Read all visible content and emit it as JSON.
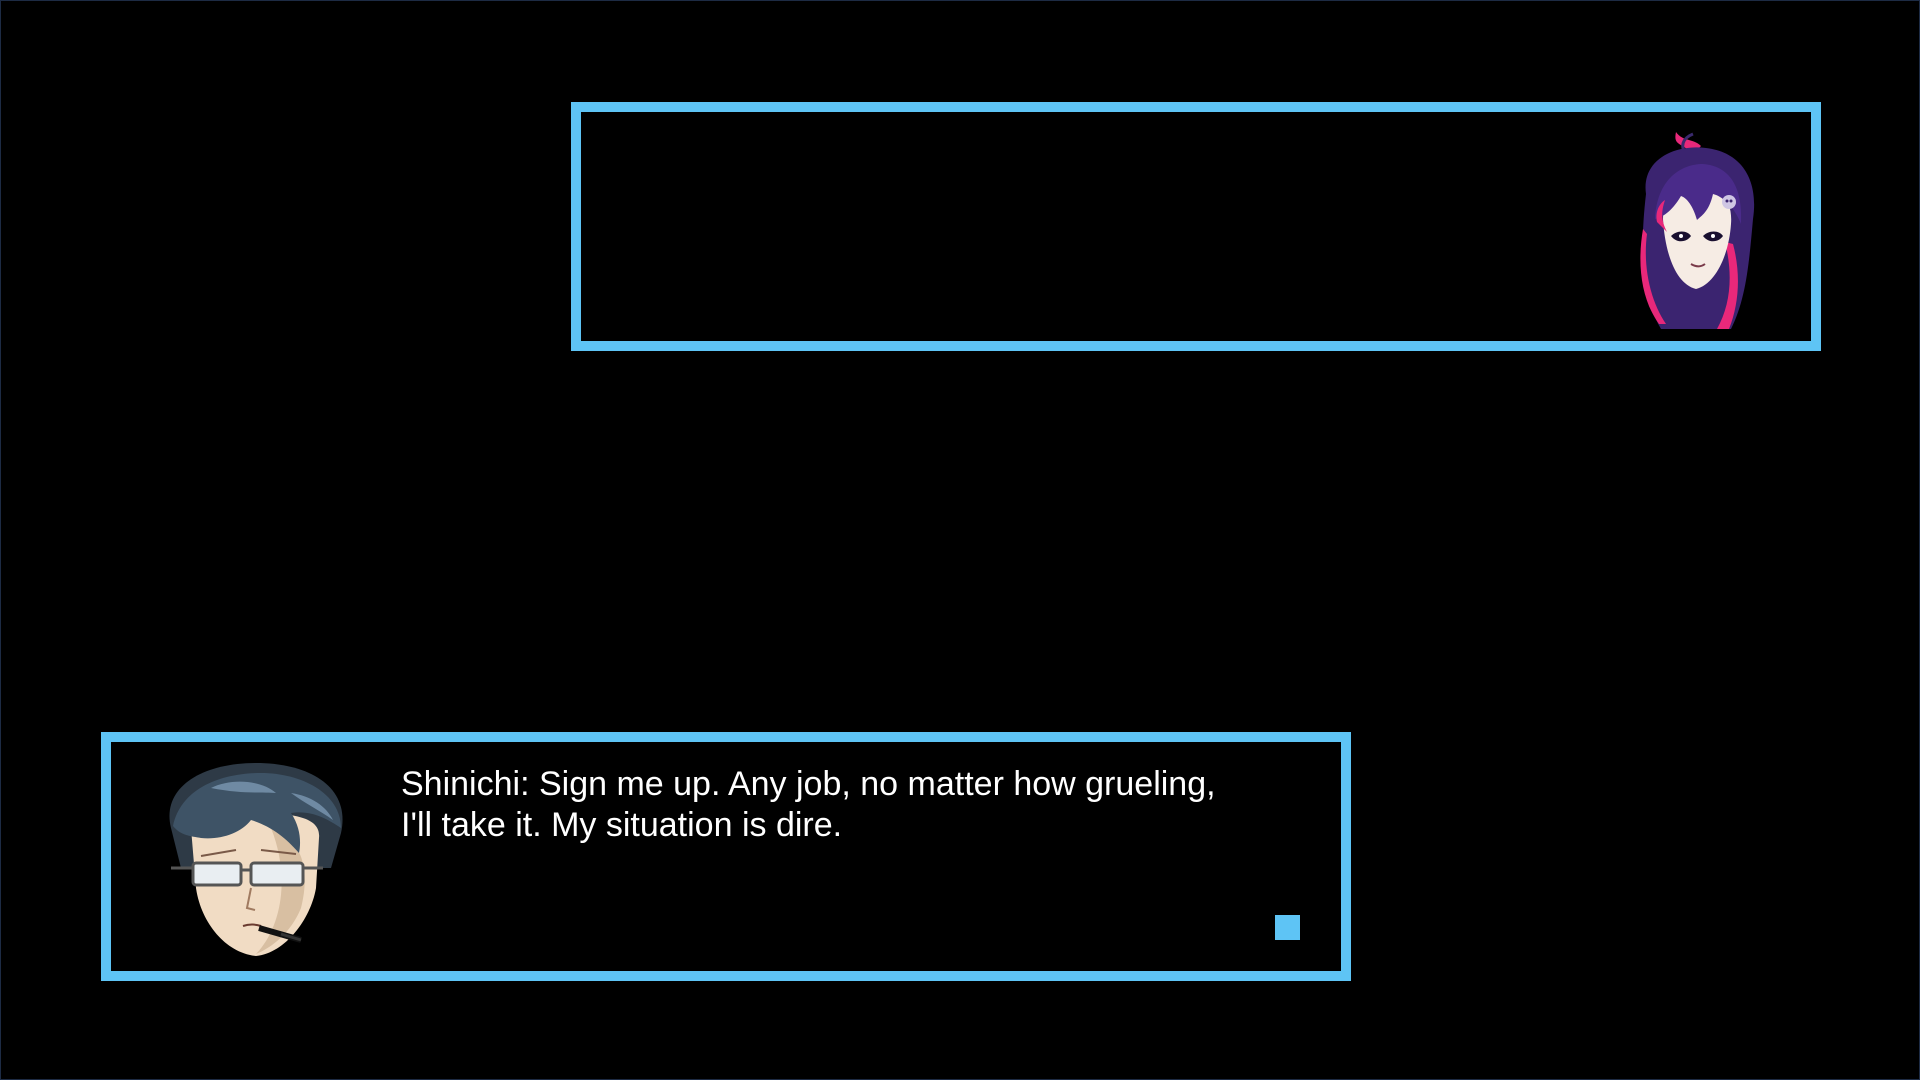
{
  "scene": {
    "background_color": "#000000",
    "accent_color": "#5ec4f5"
  },
  "top_dialog": {
    "speaker_portrait": "girl-portrait-icon",
    "text": ""
  },
  "bottom_dialog": {
    "speaker_portrait": "shinichi-portrait-icon",
    "lines": [
      "Shinichi: Sign me up. Any job, no matter how grueling,",
      "I'll take it. My situation is dire."
    ],
    "advance_icon": "advance-square-icon"
  }
}
